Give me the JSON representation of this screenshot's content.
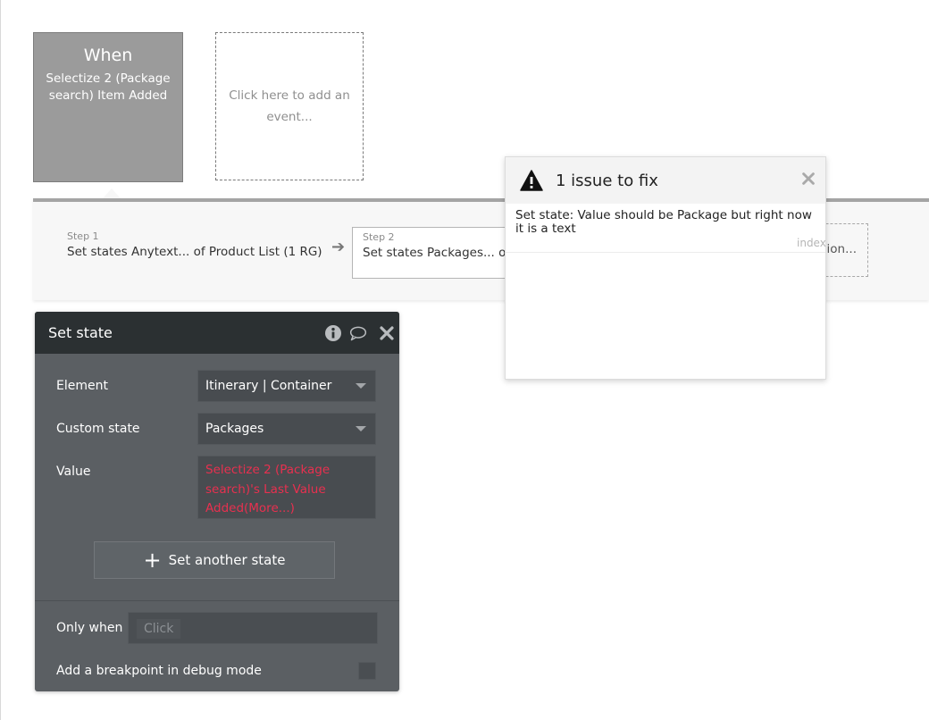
{
  "event": {
    "when_label": "When",
    "name": "Selectize 2 (Package search) Item Added",
    "add_placeholder": "Click here to add an event..."
  },
  "steps": {
    "step1": {
      "number": "Step 1",
      "text": "Set states Anytext... of Product List (1 RG)"
    },
    "step2": {
      "number": "Step 2",
      "text": "Set states Packages... of"
    },
    "add_action_partial": "ion..."
  },
  "panel": {
    "title": "Set state",
    "icons": [
      "info-icon",
      "comment-icon",
      "close-icon"
    ],
    "element_label": "Element",
    "element_value": "Itinerary | Container",
    "custom_state_label": "Custom state",
    "custom_state_value": "Packages",
    "value_label": "Value",
    "value_expression": "Selectize 2 (Package search)'s Last Value Added(More...)",
    "add_state_button": "Set another state",
    "only_when_label": "Only when",
    "only_when_placeholder": "Click",
    "breakpoint_label": "Add a breakpoint in debug mode"
  },
  "issues": {
    "title": "1 issue to fix",
    "message": "Set state: Value should be Package but right now it is a text",
    "tag": "index"
  },
  "colors": {
    "error_text": "#e8304f",
    "panel_bg": "#5b5f63",
    "panel_header": "#2b3032"
  }
}
